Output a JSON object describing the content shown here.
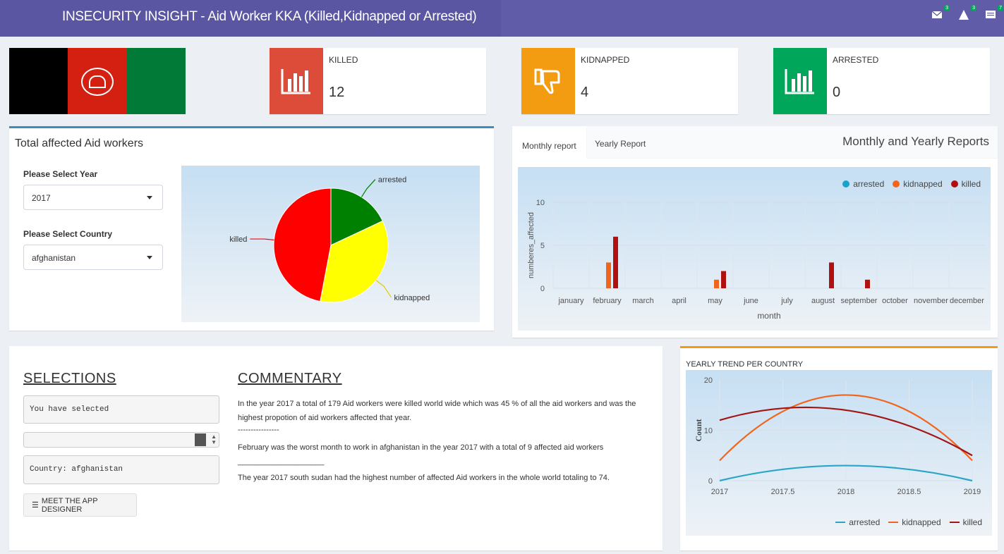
{
  "header": {
    "title": "INSECURITY INSIGHT - Aid Worker KKA (Killed,Kidnapped or Arrested)",
    "notifications": [
      {
        "icon": "envelope-icon",
        "count": "3"
      },
      {
        "icon": "warning-icon",
        "count": "3"
      },
      {
        "icon": "tasks-icon",
        "count": "7"
      }
    ]
  },
  "flag": {
    "colors": [
      "#000000",
      "#d32011",
      "#007a36"
    ]
  },
  "infoboxes": [
    {
      "label": "KILLED",
      "value": "12",
      "color": "#dd4b39",
      "icon": "bar-chart-icon"
    },
    {
      "label": "KIDNAPPED",
      "value": "4",
      "color": "#f39c12",
      "icon": "thumbs-down-icon"
    },
    {
      "label": "ARRESTED",
      "value": "0",
      "color": "#00a65a",
      "icon": "bar-chart-icon"
    }
  ],
  "left_panel": {
    "title": "Total affected Aid workers",
    "year_label": "Please Select Year",
    "year_value": "2017",
    "country_label": "Please Select Country",
    "country_value": "afghanistan"
  },
  "right_panel": {
    "tabs": [
      "Monthly report",
      "Yearly Report"
    ],
    "title": "Monthly and Yearly Reports"
  },
  "selections": {
    "heading": "SELECTIONS",
    "selected_text": "You have selected",
    "country_text": "Country:  afghanistan",
    "button_label": "MEET THE APP DESIGNER"
  },
  "commentary": {
    "heading": "COMMENTARY",
    "para1a": "In the year 2017 a total of 179 Aid workers were killed world wide which was 45 % of all the aid workers and was the",
    "para1b": "highest propotion of aid workers affected that year.",
    "sep1": "----------------",
    "para2": "February was the worst month to work in afghanistan in the year 2017 with a total of 9 affected aid workers",
    "sep2": "____________________",
    "para3": "The year 2017 south sudan had the highest number of affected Aid workers in the whole world totaling to 74."
  },
  "chart_data": [
    {
      "type": "pie",
      "labels": [
        "killed",
        "arrested",
        "kidnapped"
      ],
      "values": [
        47,
        18,
        35
      ],
      "colors": [
        "#ff0000",
        "#008000",
        "#ffff00"
      ]
    },
    {
      "type": "bar",
      "xlabel": "month",
      "ylabel": "numberes_affected",
      "categories": [
        "january",
        "february",
        "march",
        "april",
        "may",
        "june",
        "july",
        "august",
        "september",
        "october",
        "november",
        "december"
      ],
      "ylim": [
        0,
        10
      ],
      "yticks": [
        "0",
        "5",
        "10"
      ],
      "legend_position": "top-right",
      "series": [
        {
          "name": "arrested",
          "color": "#1ca1c9",
          "values": [
            0,
            0,
            0,
            0,
            0,
            0,
            0,
            0,
            0,
            0,
            0,
            0
          ]
        },
        {
          "name": "kidnapped",
          "color": "#f0651c",
          "values": [
            0,
            3,
            0,
            0,
            1,
            0,
            0,
            0,
            0,
            0,
            0,
            0
          ]
        },
        {
          "name": "killed",
          "color": "#b01010",
          "values": [
            0,
            6,
            0,
            0,
            2,
            0,
            0,
            3,
            1,
            0,
            0,
            0
          ]
        }
      ]
    },
    {
      "type": "line",
      "title": "YEARLY TREND PER COUNTRY",
      "ylabel": "Count",
      "x": [
        2017,
        2018,
        2019
      ],
      "xticks": [
        "2017",
        "2017.5",
        "2018",
        "2018.5",
        "2019"
      ],
      "yticks": [
        "0",
        "10",
        "20"
      ],
      "ylim": [
        0,
        20
      ],
      "legend_position": "bottom-right",
      "series": [
        {
          "name": "arrested",
          "color": "#2aa6c4",
          "values": [
            0,
            3,
            0
          ]
        },
        {
          "name": "kidnapped",
          "color": "#f0651c",
          "values": [
            4,
            17,
            4
          ]
        },
        {
          "name": "killed",
          "color": "#a31515",
          "values": [
            12,
            14,
            5
          ]
        }
      ]
    }
  ]
}
